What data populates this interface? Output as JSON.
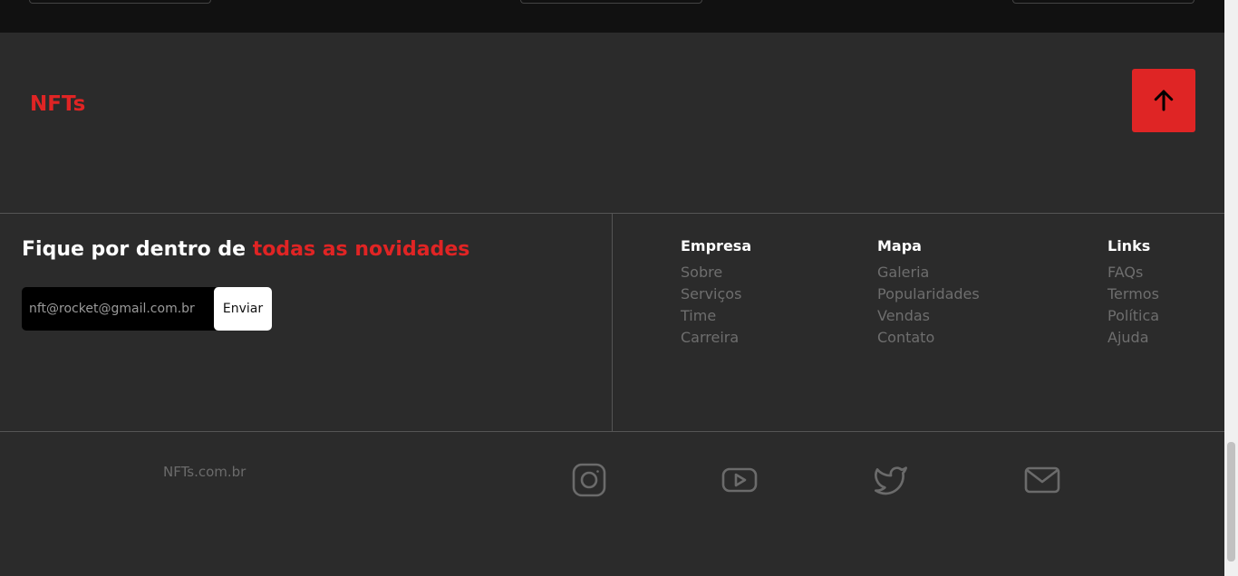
{
  "brand": "NFTs",
  "newsletter": {
    "title_prefix": "Fique por dentro de ",
    "title_highlight": "todas as novidades",
    "email_placeholder": "nft@rocket@gmail.com.br",
    "send_label": "Enviar"
  },
  "columns": [
    {
      "title": "Empresa",
      "links": [
        "Sobre",
        "Serviços",
        "Time",
        "Carreira"
      ]
    },
    {
      "title": "Mapa",
      "links": [
        "Galeria",
        "Popularidades",
        "Vendas",
        "Contato"
      ]
    },
    {
      "title": "Links",
      "links": [
        "FAQs",
        "Termos",
        "Política",
        "Ajuda"
      ]
    }
  ],
  "domain": "NFTs.com.br",
  "social_icons": [
    "instagram-icon",
    "youtube-icon",
    "twitter-icon",
    "mail-icon"
  ],
  "colors": {
    "accent": "#df2525",
    "background": "#2b2b2b",
    "muted": "#6e6e6e"
  }
}
